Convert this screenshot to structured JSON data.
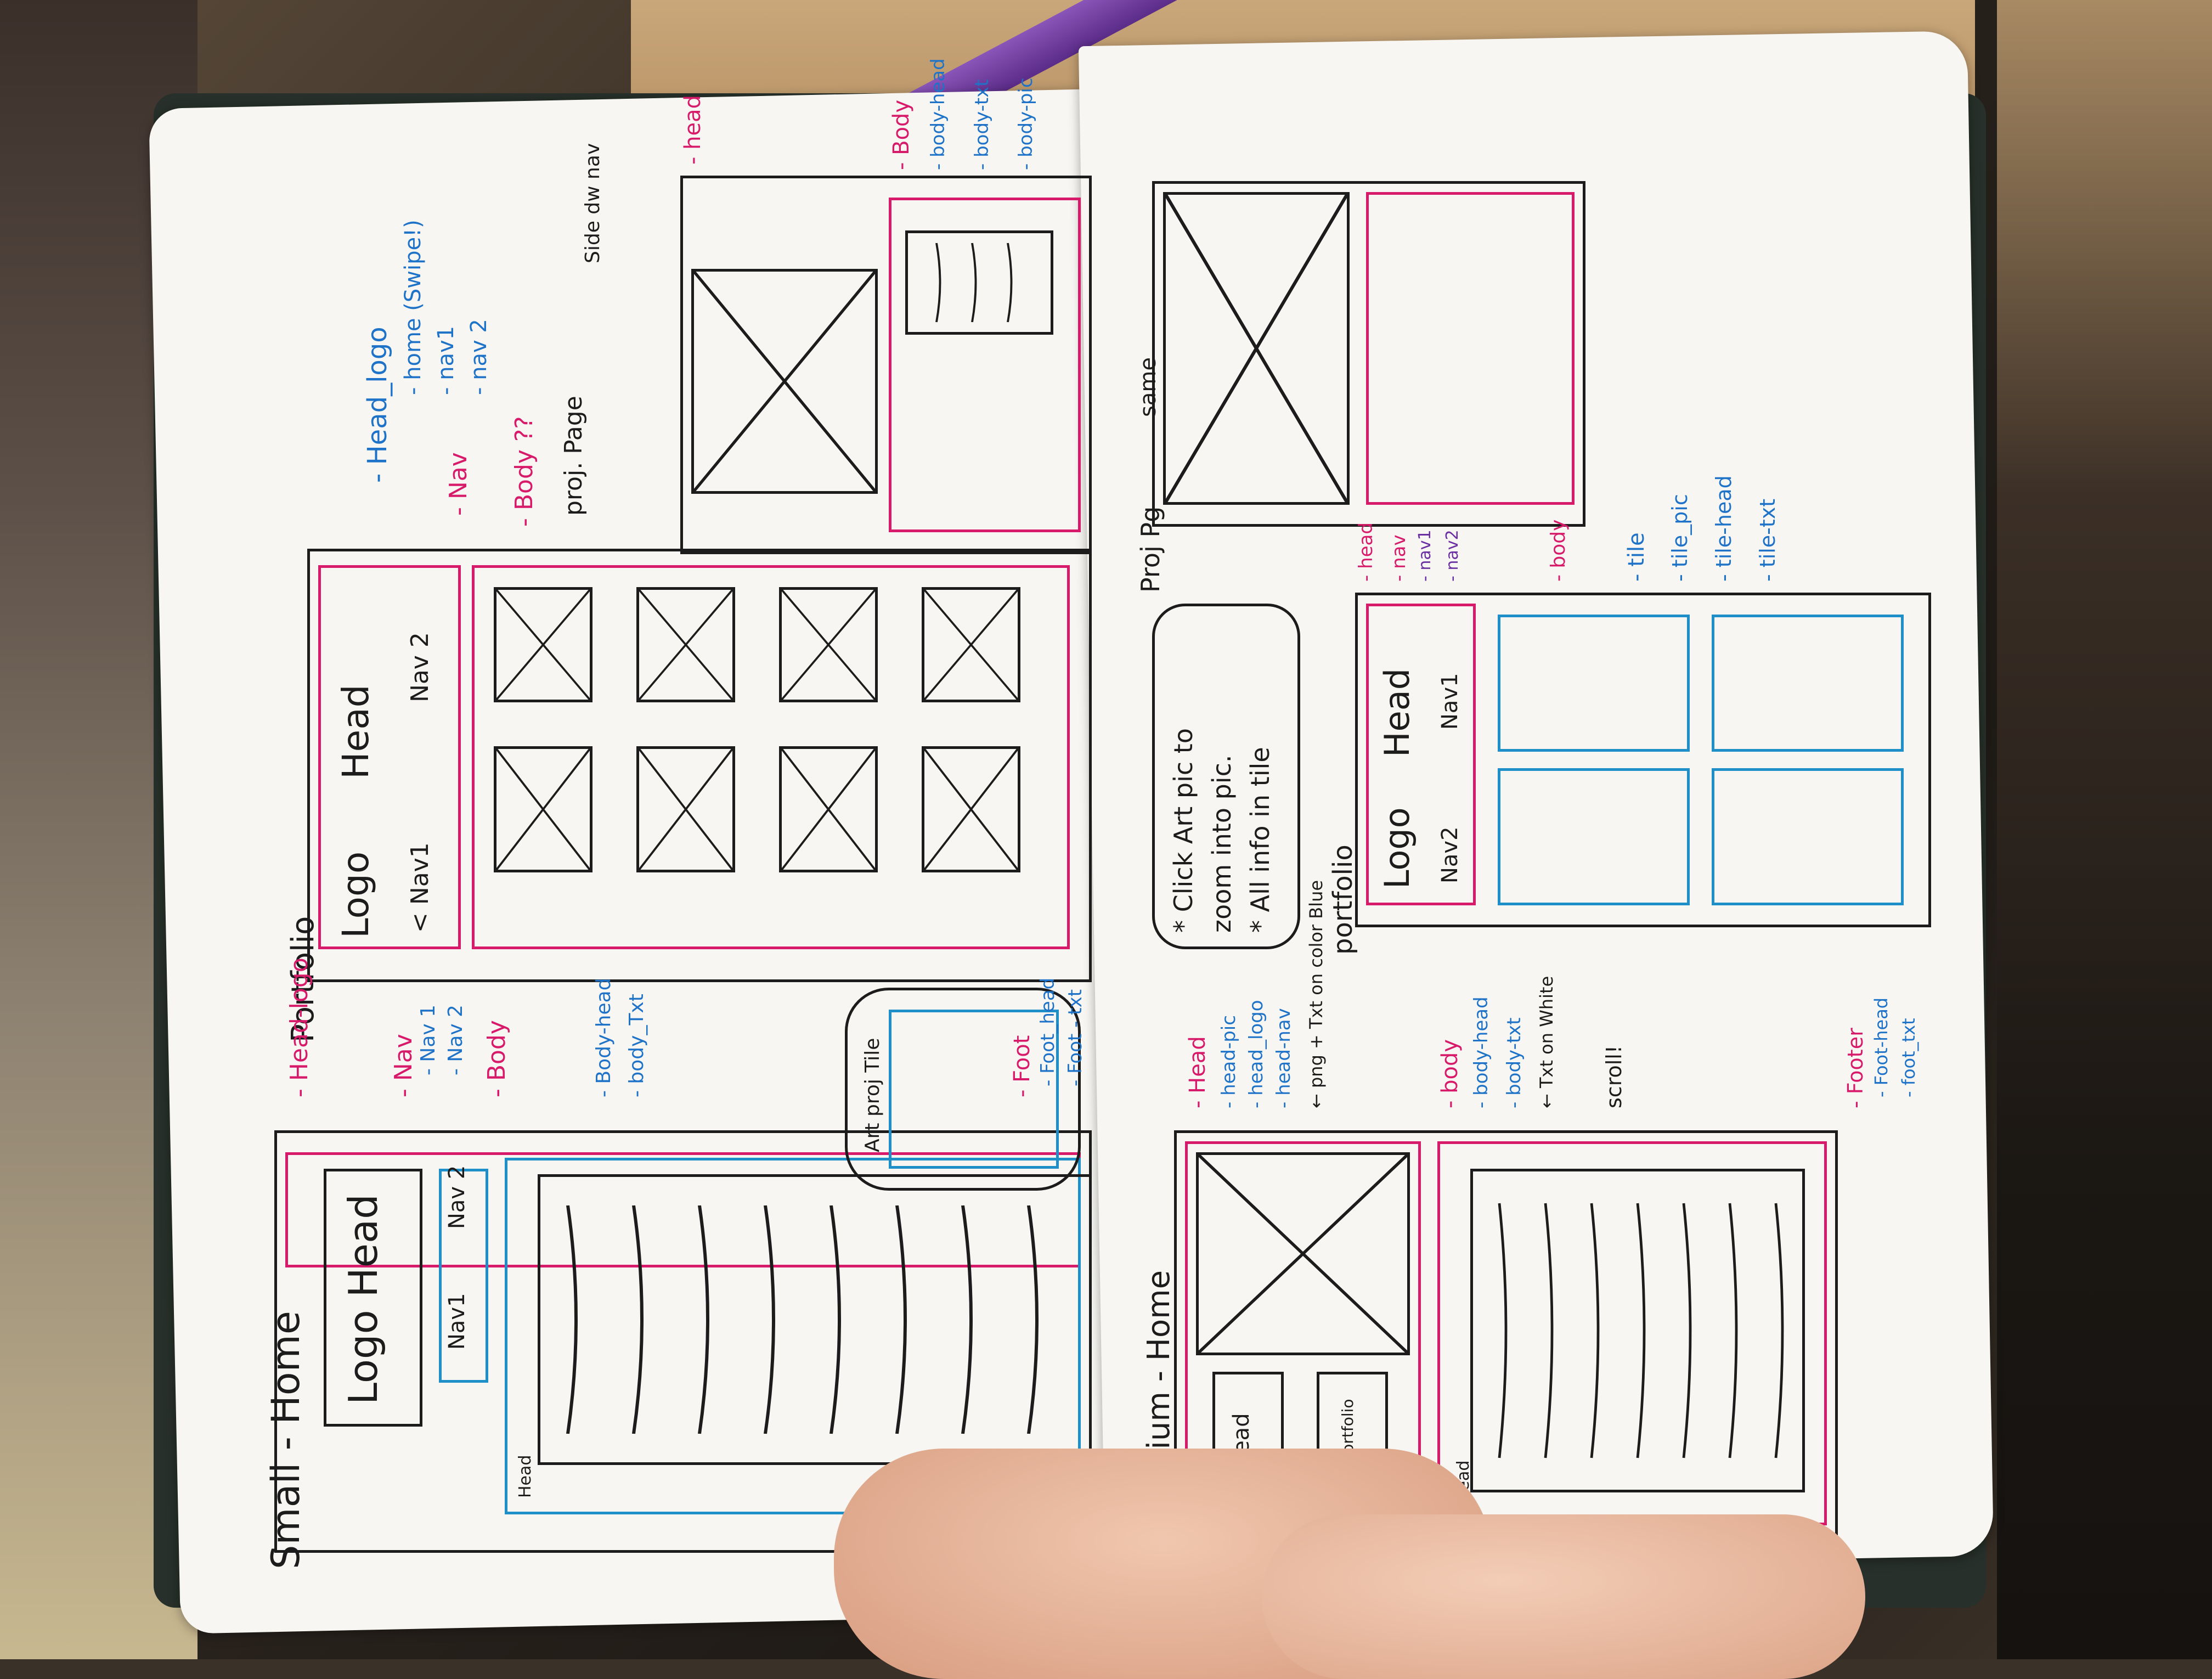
{
  "left_page": {
    "small_home": {
      "title": "Small - Home",
      "logo_head": "Logo Head",
      "nav1": "Nav1",
      "nav2": "Nav 2",
      "head_tag": "Head",
      "notes": [
        "- Head-logo",
        "- Nav",
        "- Nav 1",
        "- Nav 2",
        "- Body",
        "- Body-head",
        "- body_Txt",
        "- Foot",
        "- Foot_head",
        "- Foot - txt"
      ]
    },
    "portfolio": {
      "title": "Portfolio",
      "logo": "Logo",
      "head": "Head",
      "nav1": "< Nav1",
      "nav2": "Nav 2",
      "notes": [
        "- Head_logo",
        "- home (Swipe!)",
        "- nav1",
        "- nav 2",
        "- Nav",
        "- Body ??",
        "proj. Page",
        "Side dw nav",
        "?"
      ],
      "art_tile": "Art proj Tile"
    },
    "proj_page": {
      "notes": [
        "- head",
        "- Body",
        "- body-head",
        "- body-txt",
        "- body-pic"
      ]
    }
  },
  "right_page": {
    "medium_home": {
      "title": "Medium - Home",
      "head_btn": "Head",
      "view_portfolio": "View Portfolio",
      "head_tag": "Head",
      "notes": [
        "- Head",
        "- head-pic",
        "- head_logo",
        "- head-nav",
        "← png + Txt on color Blue",
        "- body",
        "- body-head",
        "- body-txt",
        "← Txt on White",
        "scroll!",
        "- Footer",
        "- Foot-head",
        "- foot_txt"
      ]
    },
    "callout": {
      "line1": "* Click Art pic to",
      "line2": "zoom into pic.",
      "line3": "* All info in tile"
    },
    "portfolio": {
      "title": "portfolio",
      "logo": "Logo",
      "head": "Head",
      "nav1": "Nav1",
      "nav2": "Nav2",
      "notes": [
        "- head",
        "- nav",
        "- nav1",
        "- nav2",
        "- body",
        "- tile",
        "- tile_pic",
        "- tile-head",
        "- tile-txt"
      ]
    },
    "proj_pg": {
      "label": "Proj Pg",
      "same": "same"
    }
  }
}
